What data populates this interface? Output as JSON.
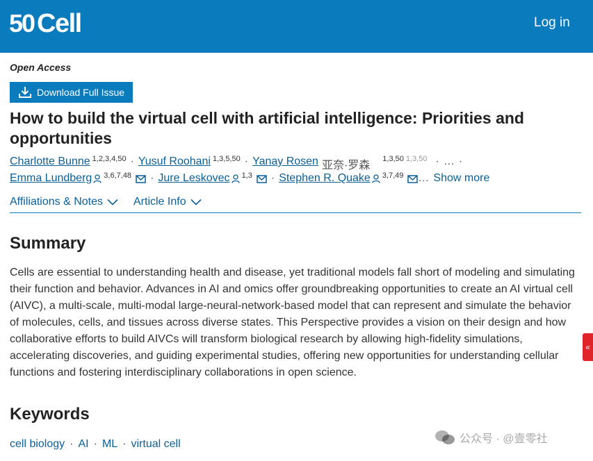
{
  "header": {
    "logo_number": "50",
    "logo_text": "Cell",
    "login_label": "Log in"
  },
  "article": {
    "access_label": "Open Access",
    "download_label": "Download Full Issue",
    "title": "How to build the virtual cell with artificial intelligence: Priorities and opportunities",
    "authors_row1": [
      {
        "name": "Charlotte Bunne",
        "sup": "1,2,3,4,50"
      },
      {
        "name": "Yusuf Roohani",
        "sup": "1,3,5,50"
      },
      {
        "name": "Yanay Rosen",
        "cjk": "亚奈·罗森",
        "sup": "1,3,50",
        "sup2": "1,3,50"
      }
    ],
    "authors_row2": [
      {
        "name": "Emma Lundberg",
        "sup": "3,6,7,48"
      },
      {
        "name": "Jure Leskovec",
        "sup": "1,3"
      },
      {
        "name": "Stephen R. Quake",
        "sup": "3,7,49"
      }
    ],
    "separator": "·",
    "ellipsis": "…",
    "show_more_label": "Show more",
    "tabs": [
      "Affiliations & Notes",
      "Article Info"
    ]
  },
  "summary": {
    "heading": "Summary",
    "text": "Cells are essential to understanding health and disease, yet traditional models fall short of modeling and simulating their function and behavior. Advances in AI and omics offer groundbreaking opportunities to create an AI virtual cell (AIVC), a multi-scale, multi-modal large-neural-network-based model that can represent and simulate the behavior of molecules, cells, and tissues across diverse states. This Perspective provides a vision on their design and how collaborative efforts to build AIVCs will transform biological research by allowing high-fidelity simulations, accelerating discoveries, and guiding experimental studies, offering new opportunities for understanding cellular functions and fostering interdisciplinary collaborations in open science."
  },
  "keywords": {
    "heading": "Keywords",
    "items": [
      "cell biology",
      "AI",
      "ML",
      "virtual cell"
    ]
  },
  "side_tab": {
    "label": "«"
  },
  "watermark": {
    "text": "公众号 · @壹零社"
  },
  "colors": {
    "brand": "#0a7bbd",
    "link": "#0a5f99",
    "side_tab": "#e0242b"
  }
}
